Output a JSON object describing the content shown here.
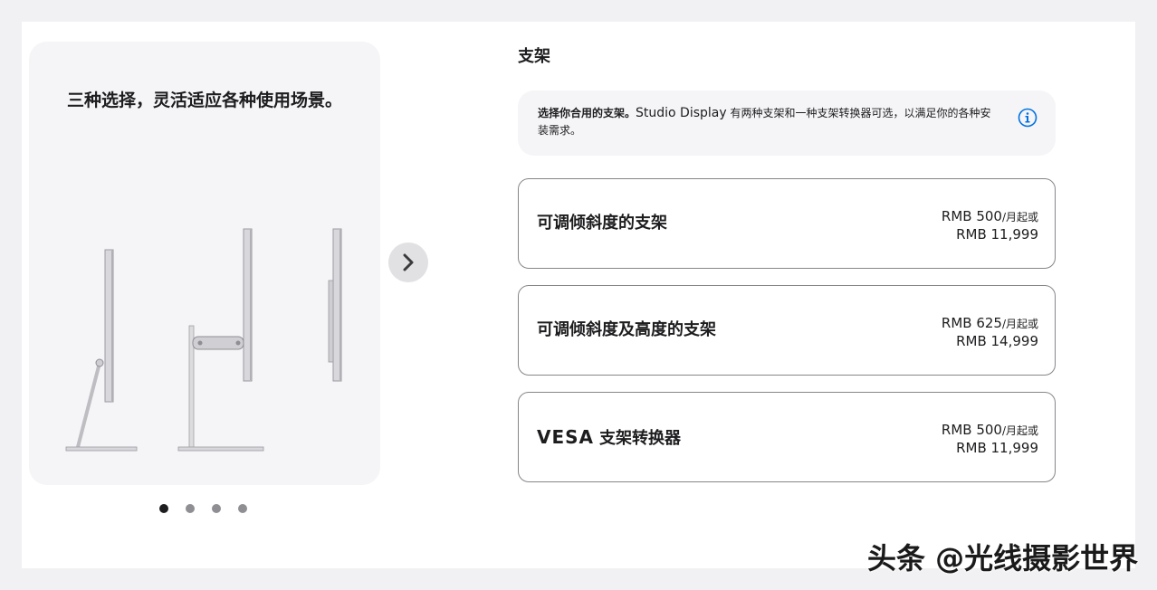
{
  "gallery": {
    "caption": "三种选择，灵活适应各种使用场景。",
    "next_icon": "chevron-right-icon",
    "page_count": 4,
    "active_page": 1
  },
  "stand": {
    "title": "支架",
    "info_bold": "选择你合用的支架。",
    "info_model": "Studio Display",
    "info_rest": " 有两种支架和一种支架转换器可选，以满足你的各种安装需求。",
    "info_icon": "info-circle-icon",
    "options": [
      {
        "name_latin": "",
        "name": "可调倾斜度的支架",
        "monthly": "RMB 500",
        "monthly_suffix": "/月起或",
        "price": "RMB 11,999"
      },
      {
        "name_latin": "",
        "name": "可调倾斜度及高度的支架",
        "monthly": "RMB 625",
        "monthly_suffix": "/月起或",
        "price": "RMB 14,999"
      },
      {
        "name_latin": "VESA",
        "name": "支架转换器",
        "monthly": "RMB 500",
        "monthly_suffix": "/月起或",
        "price": "RMB 11,999"
      }
    ]
  },
  "watermark": "头条 @光线摄影世界",
  "colors": {
    "accent": "#0071e3",
    "border": "#86868b",
    "panel": "#f5f5f7"
  }
}
